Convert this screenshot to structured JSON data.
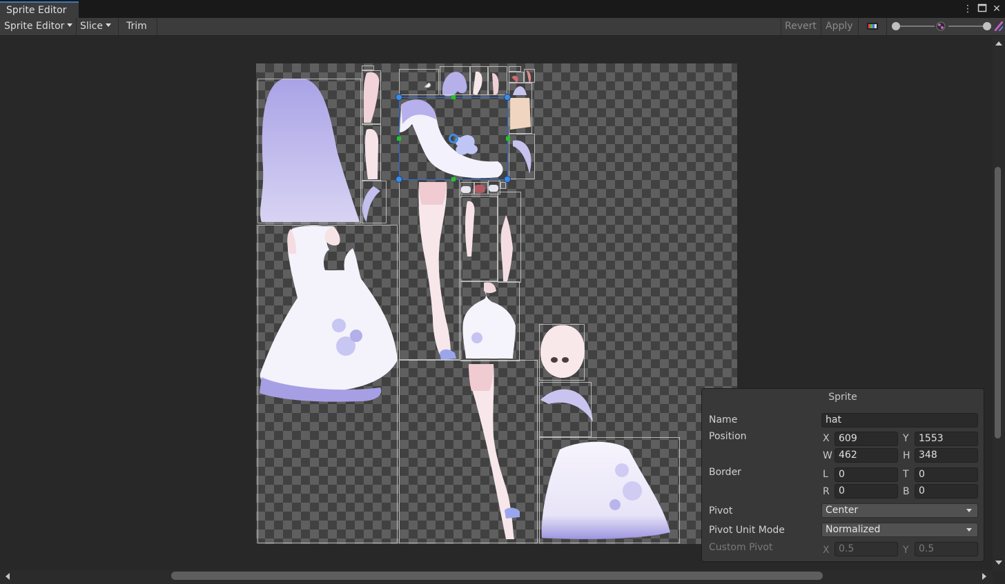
{
  "window": {
    "tab_title": "Sprite Editor",
    "menu_icon": "kebab-menu-icon",
    "maximize_icon": "maximize-icon",
    "close_icon": "close-icon"
  },
  "toolbar": {
    "mode_dropdown": "Sprite Editor",
    "slice_dropdown": "Slice",
    "trim_label": "Trim",
    "revert_label": "Revert",
    "apply_label": "Apply",
    "color_channel_icon": "rgb-channel-icon",
    "alpha_icon": "alpha-toggle-icon",
    "mip_icon": "mip-level-icon"
  },
  "colors": {
    "accent": "#3a79bb",
    "selection_outline": "#2f6fd8",
    "handle_green": "#1fc81f",
    "handle_blue": "#3c8ce6"
  },
  "sprite_panel": {
    "title": "Sprite",
    "name_label": "Name",
    "name_value": "hat",
    "position_label": "Position",
    "x_label": "X",
    "x_value": "609",
    "y_label": "Y",
    "y_value": "1553",
    "w_label": "W",
    "w_value": "462",
    "h_label": "H",
    "h_value": "348",
    "border_label": "Border",
    "l_label": "L",
    "l_value": "0",
    "t_label": "T",
    "t_value": "0",
    "r_label": "R",
    "r_value": "0",
    "b_label": "B",
    "b_value": "0",
    "pivot_label": "Pivot",
    "pivot_value": "Center",
    "pivot_unit_mode_label": "Pivot Unit Mode",
    "pivot_unit_mode_value": "Normalized",
    "custom_pivot_label": "Custom Pivot",
    "custom_pivot_x_label": "X",
    "custom_pivot_x_value": "0.5",
    "custom_pivot_y_label": "Y",
    "custom_pivot_y_value": "0.5"
  }
}
